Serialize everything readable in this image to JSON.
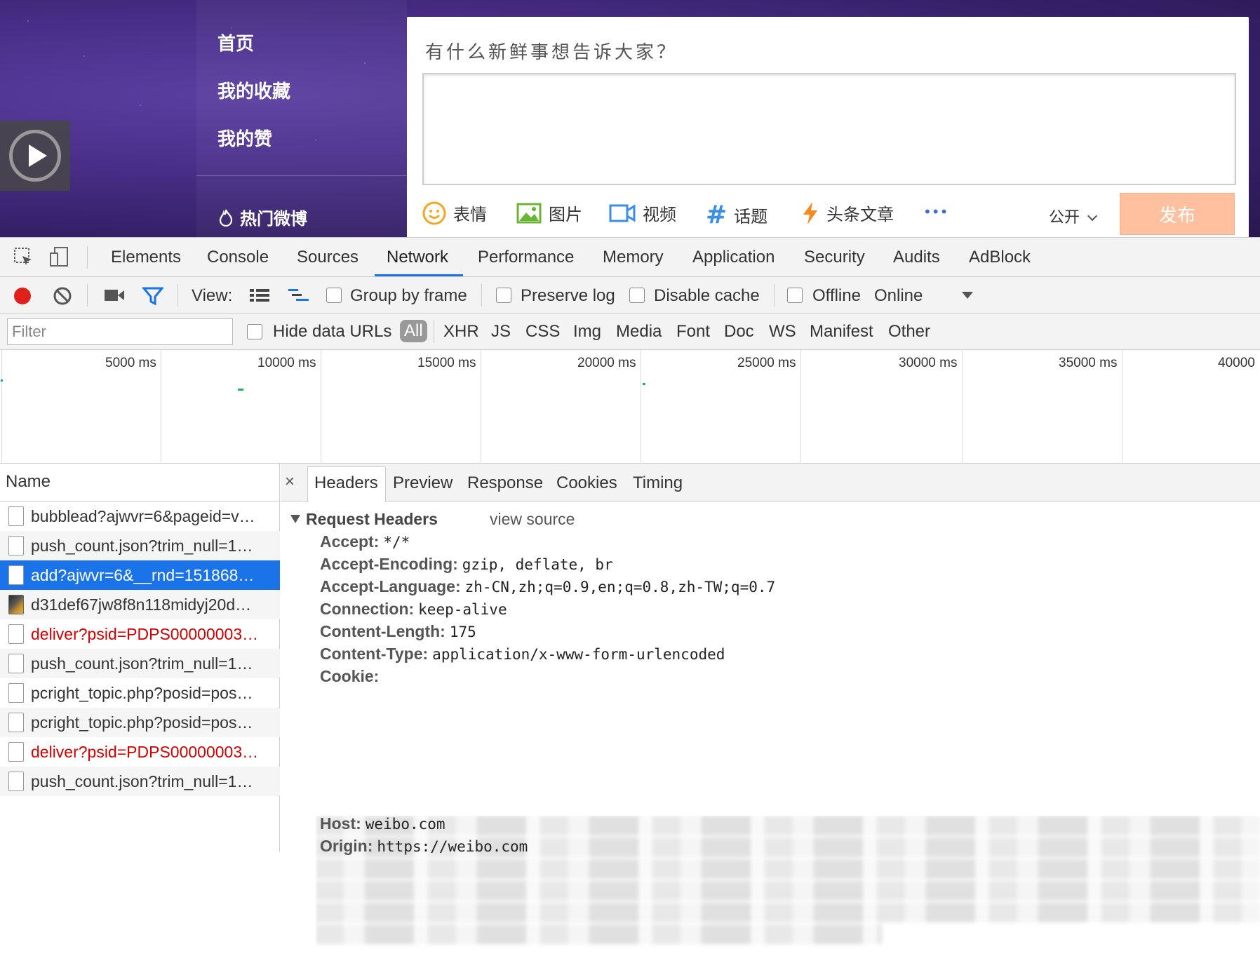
{
  "weibo": {
    "nav": [
      "首页",
      "我的收藏",
      "我的赞"
    ],
    "hot": "热门微博",
    "composer": {
      "title": "有什么新鲜事想告诉大家？",
      "tools": [
        "表情",
        "图片",
        "视频",
        "话题",
        "头条文章"
      ],
      "more": "•••",
      "visibility": "公开",
      "publish": "发布"
    }
  },
  "devtools": {
    "tabs": [
      "Elements",
      "Console",
      "Sources",
      "Network",
      "Performance",
      "Memory",
      "Application",
      "Security",
      "Audits",
      "AdBlock"
    ],
    "active_tab": "Network",
    "toolbar": {
      "view_label": "View:",
      "group_by_frame": "Group by frame",
      "preserve_log": "Preserve log",
      "disable_cache": "Disable cache",
      "offline": "Offline",
      "throttle": "Online"
    },
    "filter": {
      "placeholder": "Filter",
      "hide_data_urls": "Hide data URLs",
      "types": [
        "All",
        "XHR",
        "JS",
        "CSS",
        "Img",
        "Media",
        "Font",
        "Doc",
        "WS",
        "Manifest",
        "Other"
      ],
      "active_type": "All"
    },
    "overview_ticks": [
      "5000 ms",
      "10000 ms",
      "15000 ms",
      "20000 ms",
      "25000 ms",
      "30000 ms",
      "35000 ms",
      "40000"
    ],
    "name_header": "Name",
    "requests": [
      {
        "name": "bubblead?ajwvr=6&pageid=v…",
        "type": "doc",
        "state": "normal"
      },
      {
        "name": "push_count.json?trim_null=1…",
        "type": "doc",
        "state": "normal"
      },
      {
        "name": "add?ajwvr=6&__rnd=151868…",
        "type": "doc",
        "state": "selected"
      },
      {
        "name": "d31def67jw8f8n118midyj20d…",
        "type": "img",
        "state": "normal"
      },
      {
        "name": "deliver?psid=PDPS00000003…",
        "type": "doc",
        "state": "error"
      },
      {
        "name": "push_count.json?trim_null=1…",
        "type": "doc",
        "state": "normal"
      },
      {
        "name": "pcright_topic.php?posid=pos…",
        "type": "doc",
        "state": "normal"
      },
      {
        "name": "pcright_topic.php?posid=pos…",
        "type": "doc",
        "state": "normal"
      },
      {
        "name": "deliver?psid=PDPS00000003…",
        "type": "doc",
        "state": "error"
      },
      {
        "name": "push_count.json?trim_null=1…",
        "type": "doc",
        "state": "normal"
      }
    ],
    "detail": {
      "close": "×",
      "tabs": [
        "Headers",
        "Preview",
        "Response",
        "Cookies",
        "Timing"
      ],
      "active_tab": "Headers",
      "section_title": "Request Headers",
      "view_source": "view source",
      "headers": [
        {
          "key": "Accept:",
          "value": "*/*"
        },
        {
          "key": "Accept-Encoding:",
          "value": "gzip, deflate, br"
        },
        {
          "key": "Accept-Language:",
          "value": "zh-CN,zh;q=0.9,en;q=0.8,zh-TW;q=0.7"
        },
        {
          "key": "Connection:",
          "value": "keep-alive"
        },
        {
          "key": "Content-Length:",
          "value": "175"
        },
        {
          "key": "Content-Type:",
          "value": "application/x-www-form-urlencoded"
        },
        {
          "key": "Cookie:",
          "value": ""
        }
      ],
      "headers_after": [
        {
          "key": "Host:",
          "value": "weibo.com"
        },
        {
          "key": "Origin:",
          "value": "https://weibo.com"
        }
      ]
    }
  },
  "colors": {
    "accent": "#1a73e8",
    "record": "#e0201b",
    "error_text": "#d20000",
    "publish_bg": "#ffc09f"
  }
}
